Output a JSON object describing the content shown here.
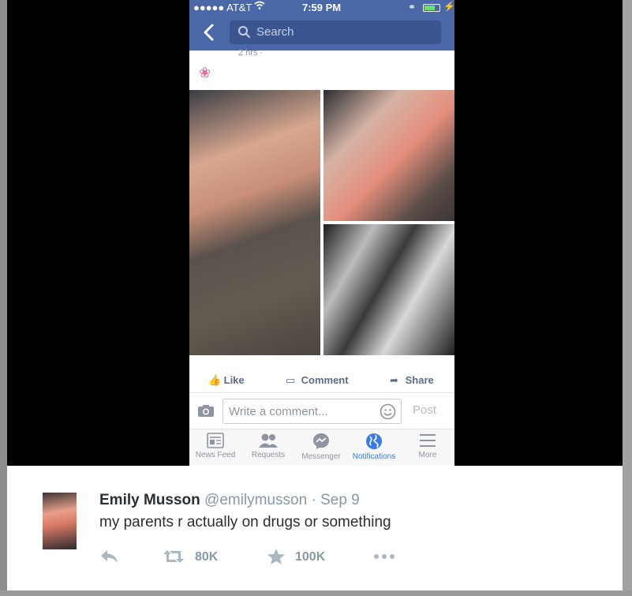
{
  "status_bar": {
    "carrier": "●●●●● AT&T",
    "time": "7:59 PM"
  },
  "nav": {
    "search_placeholder": "Search"
  },
  "post": {
    "meta": "2 hrs ·",
    "photos": [
      "photo-left",
      "photo-top-right",
      "photo-bottom-right"
    ]
  },
  "actions": {
    "like": "Like",
    "comment": "Comment",
    "share": "Share"
  },
  "comment_box": {
    "placeholder": "Write a comment...",
    "post_label": "Post"
  },
  "tabs": [
    {
      "label": "News Feed",
      "icon": "news-feed-icon",
      "active": false
    },
    {
      "label": "Requests",
      "icon": "requests-icon",
      "active": false
    },
    {
      "label": "Messenger",
      "icon": "messenger-icon",
      "active": false
    },
    {
      "label": "Notifications",
      "icon": "globe-icon",
      "active": true
    },
    {
      "label": "More",
      "icon": "menu-icon",
      "active": false
    }
  ],
  "tweet": {
    "name": "Emily Musson",
    "handle": "@emilymusson",
    "separator": "·",
    "date": "Sep 9",
    "text": "my parents r actually on drugs or something",
    "retweets": "80K",
    "favorites": "100K"
  },
  "colors": {
    "facebook_blue": "#4a67a8",
    "active_tab": "#3b7be8",
    "twitter_gray": "#8899a6"
  }
}
